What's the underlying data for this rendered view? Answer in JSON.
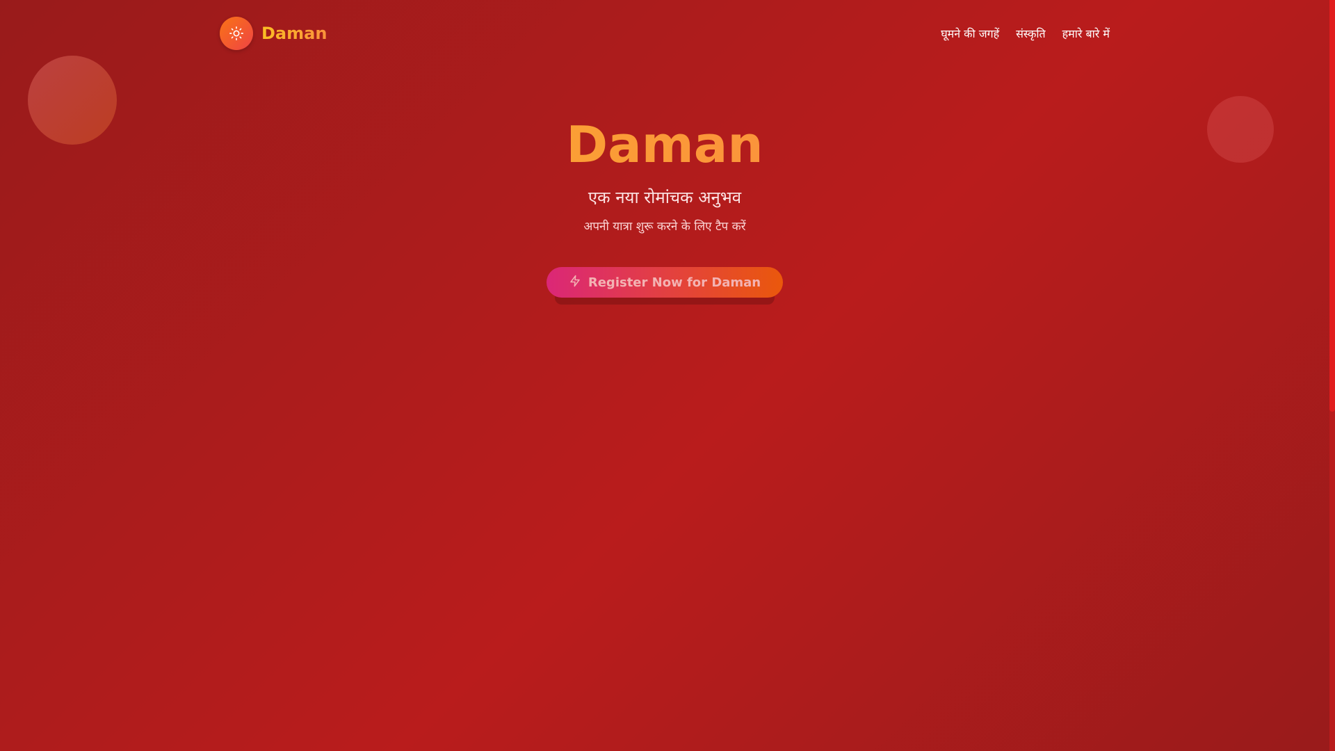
{
  "nav": {
    "logo_icon": "sun-icon",
    "logo_text": "Daman",
    "links": [
      {
        "label": "घूमने की जगहें"
      },
      {
        "label": "संस्कृति"
      },
      {
        "label": "हमारे बारे में"
      }
    ]
  },
  "hero": {
    "title": "Daman",
    "subtitle": "एक नया रोमांचक अनुभव",
    "note": "अपनी यात्रा शुरू करने के लिए टैप करें",
    "cta_label": "Register Now for Daman",
    "cta_icon": "lightning-icon"
  },
  "colors": {
    "background": "#b91c1c",
    "accent": "#fb923c",
    "logo_text": "#fbbf24",
    "button_start": "#db2777",
    "button_end": "#ea580c"
  }
}
